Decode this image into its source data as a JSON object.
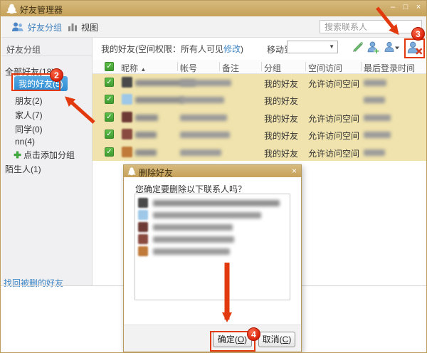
{
  "window": {
    "title": "好友管理器"
  },
  "icons": {
    "minimize": "–",
    "maximize": "□",
    "close": "×",
    "check": "✓",
    "sort_asc": "▲",
    "dropdown": "▼",
    "qq_logo": "penguin-logo",
    "friend_groups": "people-icon",
    "view": "bar-chart-icon",
    "edit": "pencil-icon",
    "add_friend": "person-plus-icon",
    "friend_options": "person-dropdown-icon",
    "delete_friend": "person-delete-icon",
    "add_group": "green-plus-icon"
  },
  "toolbar": {
    "friend_groups": "好友分组",
    "view": "视图",
    "search_placeholder": "搜索联系人"
  },
  "sidebar": {
    "header": "好友分组",
    "items": [
      {
        "label": "全部好友(18)"
      },
      {
        "label": "我的好友(5)",
        "selected": true
      },
      {
        "label": "朋友(2)"
      },
      {
        "label": "家人(7)"
      },
      {
        "label": "同学(0)"
      },
      {
        "label": "nn(4)"
      },
      {
        "label": "点击添加分组",
        "add": true
      },
      {
        "label": "陌生人(1)"
      }
    ],
    "recover_link": "找回被删的好友"
  },
  "main": {
    "caption_prefix": "我的好友(空间权限：所有人可见",
    "modify_link": "修改",
    "caption_suffix": ")",
    "move_to_label": "移动到",
    "table": {
      "columns": [
        "昵称",
        "帐号",
        "备注",
        "分组",
        "空间访问",
        "最后登录时间"
      ],
      "rows": [
        {
          "group": "我的好友",
          "access": "允许访问空间"
        },
        {
          "group": "我的好友",
          "access": ""
        },
        {
          "group": "我的好友",
          "access": "允许访问空间"
        },
        {
          "group": "我的好友",
          "access": "允许访问空间"
        },
        {
          "group": "我的好友",
          "access": "允许访问空间"
        }
      ]
    }
  },
  "dialog": {
    "title": "删除好友",
    "prompt": "您确定要删除以下联系人吗？",
    "ok": {
      "pre": "确定(",
      "key": "O",
      "post": ")"
    },
    "cancel": {
      "pre": "取消(",
      "key": "C",
      "post": ")"
    }
  },
  "annotations": {
    "step2": "2",
    "step3": "3",
    "step4": "4"
  },
  "colors": {
    "titlebar": "#CDAA68",
    "accent_red": "#E23A0E",
    "selected_blue": "#3D9BE0",
    "row_highlight": "#F0E3AD",
    "check_green": "#4EA53C",
    "link_blue": "#3E87C8"
  }
}
